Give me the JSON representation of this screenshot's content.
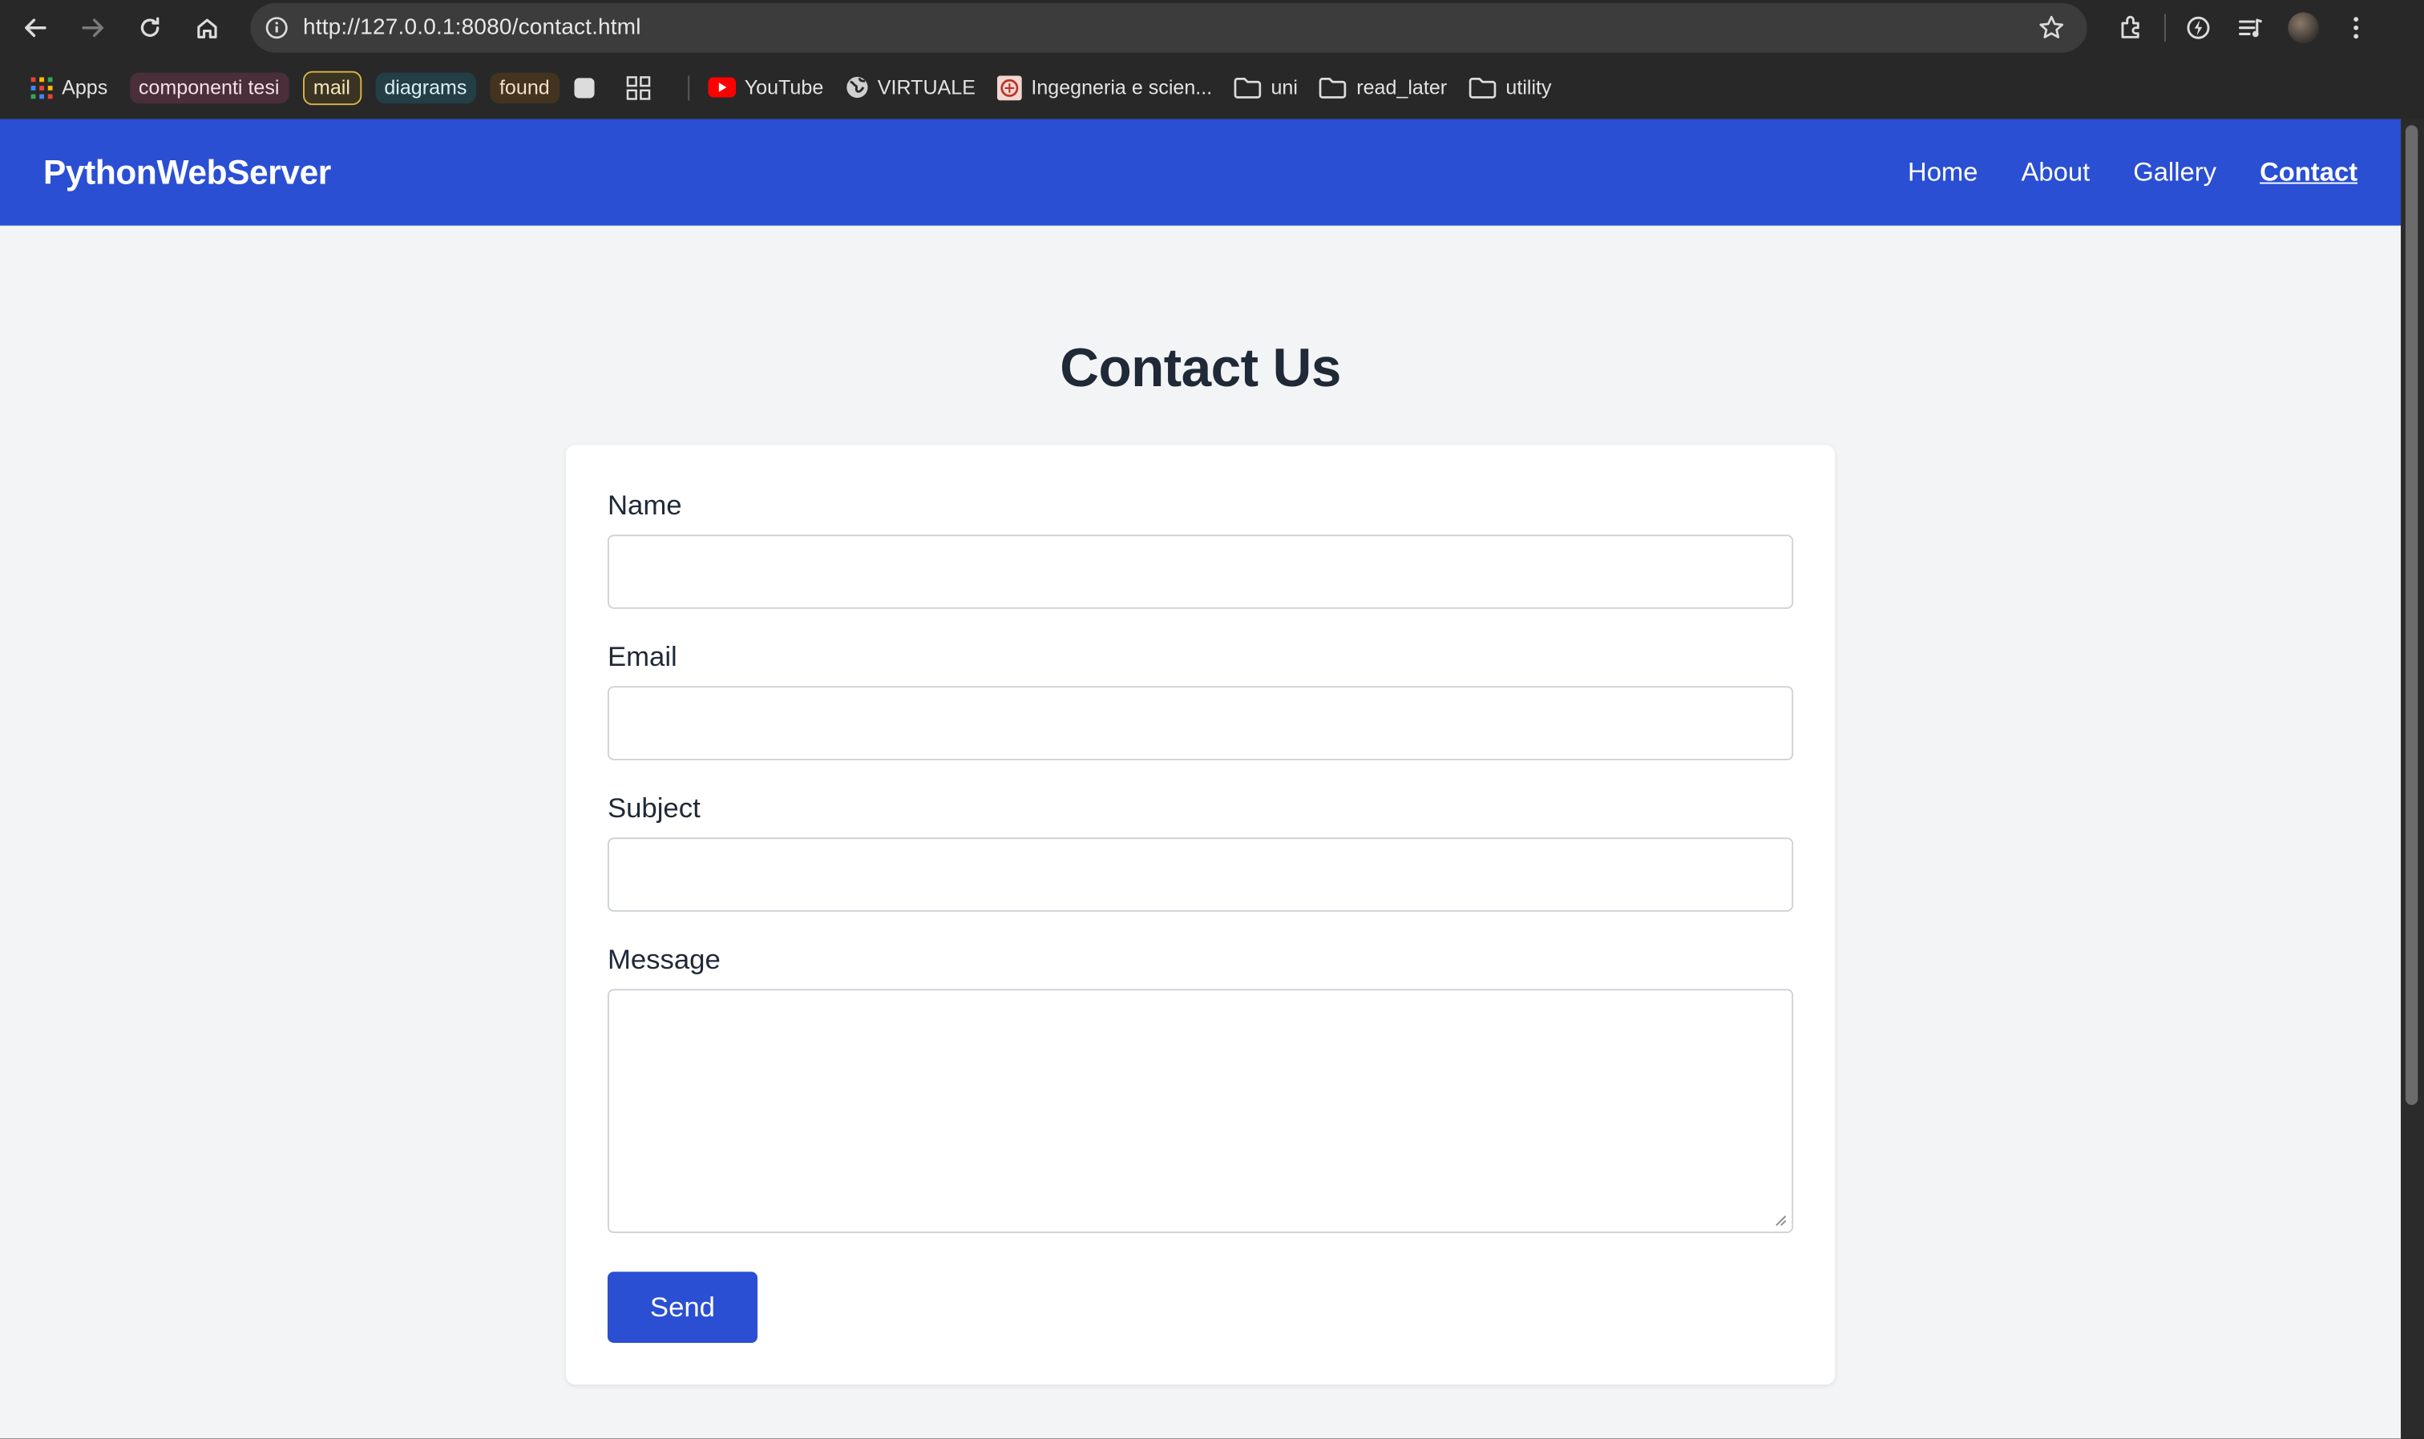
{
  "browser": {
    "url": "http://127.0.0.1:8080/contact.html",
    "icons": [
      "back-arrow-icon",
      "forward-arrow-icon",
      "reload-icon",
      "home-icon",
      "site-info-icon",
      "star-icon",
      "extensions-icon",
      "performance-icon",
      "reading-list-icon",
      "profile-avatar",
      "menu-dots-icon"
    ]
  },
  "bookmarks": {
    "apps": "Apps",
    "chips": [
      "componenti tesi",
      "mail",
      "diagrams",
      "found"
    ],
    "youtube": "YouTube",
    "virtuale": "VIRTUALE",
    "ingegneria": "Ingegneria e scien...",
    "folders": [
      "uni",
      "read_later",
      "utility"
    ]
  },
  "site": {
    "brand": "PythonWebServer",
    "nav": [
      "Home",
      "About",
      "Gallery",
      "Contact"
    ],
    "active_nav": "Contact",
    "accent": "#2a4fd3"
  },
  "contact": {
    "title": "Contact Us",
    "labels": {
      "name": "Name",
      "email": "Email",
      "subject": "Subject",
      "message": "Message"
    },
    "send": "Send"
  }
}
